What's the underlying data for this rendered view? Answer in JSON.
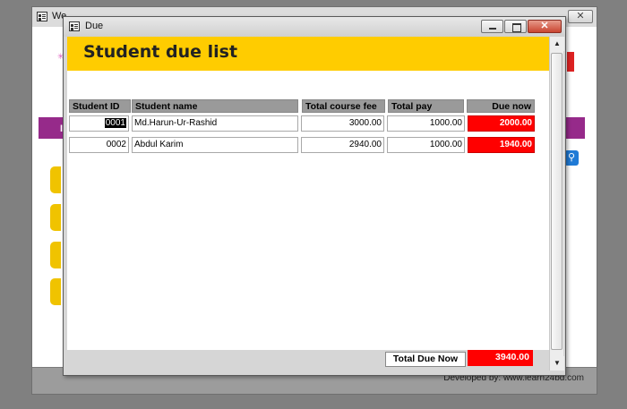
{
  "background_window": {
    "title": "We",
    "purple_bar_text": "I",
    "footer_text": "Developed by: www.learn24bd.com"
  },
  "dialog": {
    "title": "Due",
    "header": "Student due list",
    "columns": [
      "Student ID",
      "Student name",
      "Total course fee",
      "Total pay",
      "Due now"
    ],
    "rows": [
      {
        "id": "0001",
        "name": "Md.Harun-Ur-Rashid",
        "fee": "3000.00",
        "pay": "1000.00",
        "due": "2000.00"
      },
      {
        "id": "0002",
        "name": "Abdul Karim",
        "fee": "2940.00",
        "pay": "1000.00",
        "due": "1940.00"
      }
    ],
    "total_label": "Total Due Now",
    "total_value": "3940.00"
  },
  "colors": {
    "header_band": "#ffcc00",
    "due_red": "#ff0000",
    "purple_bar": "#962a8a"
  }
}
